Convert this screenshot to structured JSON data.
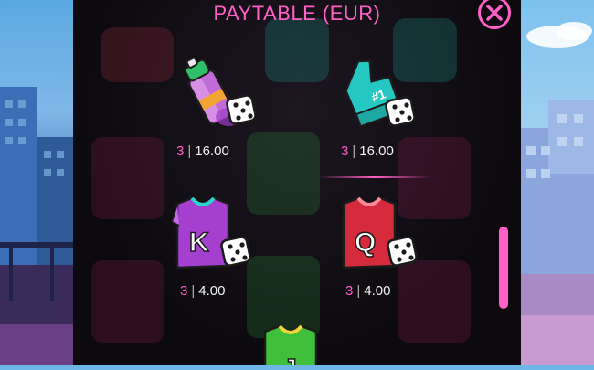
{
  "title": "PAYTABLE (EUR)",
  "symbols": [
    {
      "name": "spray-can",
      "count": "3",
      "separator": "|",
      "value": "16.00"
    },
    {
      "name": "foam-finger",
      "count": "3",
      "separator": "|",
      "value": "16.00"
    },
    {
      "name": "jersey-k",
      "count": "3",
      "separator": "|",
      "value": "4.00",
      "letter": "K"
    },
    {
      "name": "jersey-q",
      "count": "3",
      "separator": "|",
      "value": "4.00",
      "letter": "Q"
    },
    {
      "name": "jersey-j",
      "letter": "J"
    }
  ],
  "colors": {
    "accent": "#ff5fc6",
    "panel": "#0c0a0e"
  }
}
